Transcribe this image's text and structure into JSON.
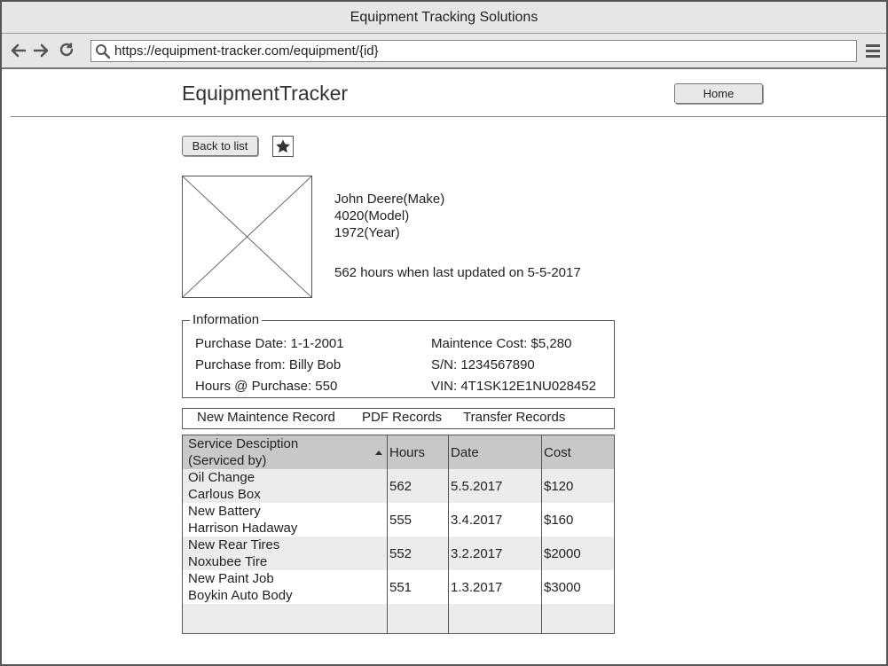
{
  "window": {
    "title": "Equipment Tracking Solutions"
  },
  "browser": {
    "url": "https://equipment-tracker.com/equipment/{id}"
  },
  "header": {
    "brand": "EquipmentTracker",
    "home_label": "Home"
  },
  "toolbar": {
    "back_label": "Back to list"
  },
  "equipment": {
    "make": "John Deere(Make)",
    "model": "4020(Model)",
    "year": "1972(Year)",
    "hours_status": "562 hours when last updated on 5-5-2017"
  },
  "information": {
    "legend": "Information",
    "purchase_date": "Purchase Date: 1-1-2001",
    "purchase_from": "Purchase from: Billy Bob",
    "hours_at_purchase": "Hours @ Purchase: 550",
    "maintenance_cost": "Maintence Cost: $5,280",
    "serial": "S/N: 1234567890",
    "vin": "VIN: 4T1SK12E1NU028452"
  },
  "actions": {
    "new_record": "New Maintence Record",
    "pdf_records": "PDF Records",
    "transfer_records": "Transfer Records"
  },
  "table": {
    "headers": {
      "service_line1": "Service Desciption",
      "service_line2": "(Serviced by)",
      "hours": "Hours",
      "date": "Date",
      "cost": "Cost"
    },
    "rows": [
      {
        "service": "Oil Change",
        "by": "Carlous Box",
        "hours": "562",
        "date": "5.5.2017",
        "cost": "$120"
      },
      {
        "service": "New Battery",
        "by": "Harrison Hadaway",
        "hours": "555",
        "date": "3.4.2017",
        "cost": "$160"
      },
      {
        "service": "New Rear Tires",
        "by": "Noxubee Tire",
        "hours": "552",
        "date": "3.2.2017",
        "cost": "$2000"
      },
      {
        "service": "New Paint Job",
        "by": "Boykin Auto Body",
        "hours": "551",
        "date": "1.3.2017",
        "cost": "$3000"
      }
    ]
  },
  "icons": {
    "back": "arrow-left-icon",
    "forward": "arrow-right-icon",
    "reload": "reload-icon",
    "search": "search-icon",
    "menu": "hamburger-menu-icon",
    "favorite": "star-icon",
    "image": "image-placeholder-icon",
    "sort": "sort-ascending-icon"
  }
}
